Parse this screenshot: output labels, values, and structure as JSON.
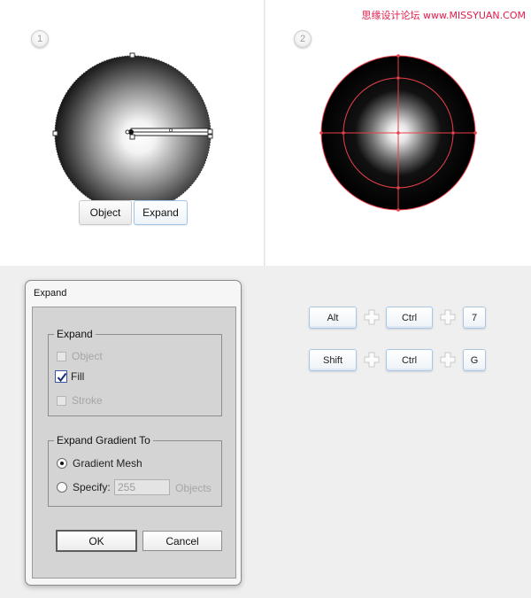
{
  "watermark": "思缘设计论坛  www.MISSYUAN.COM",
  "steps": [
    "1",
    "2"
  ],
  "context_control": {
    "object_label": "Object",
    "expand_label": "Expand"
  },
  "dialog": {
    "title": "Expand",
    "expand_group": {
      "legend": "Expand",
      "object_label": "Object",
      "fill_label": "Fill",
      "stroke_label": "Stroke",
      "fill_checked": true
    },
    "gradient_group": {
      "legend": "Expand Gradient To",
      "gradient_mesh_label": "Gradient Mesh",
      "specify_label": "Specify:",
      "specify_value": "255",
      "objects_label": "Objects",
      "selected": "Gradient Mesh"
    },
    "ok_label": "OK",
    "cancel_label": "Cancel"
  },
  "shortcuts": [
    [
      "Alt",
      "Ctrl",
      "7"
    ],
    [
      "Shift",
      "Ctrl",
      "G"
    ]
  ],
  "colors": {
    "mesh_lines": "#e8404a",
    "watermark": "#e01b4a",
    "key_border": "#a9c8e6"
  }
}
